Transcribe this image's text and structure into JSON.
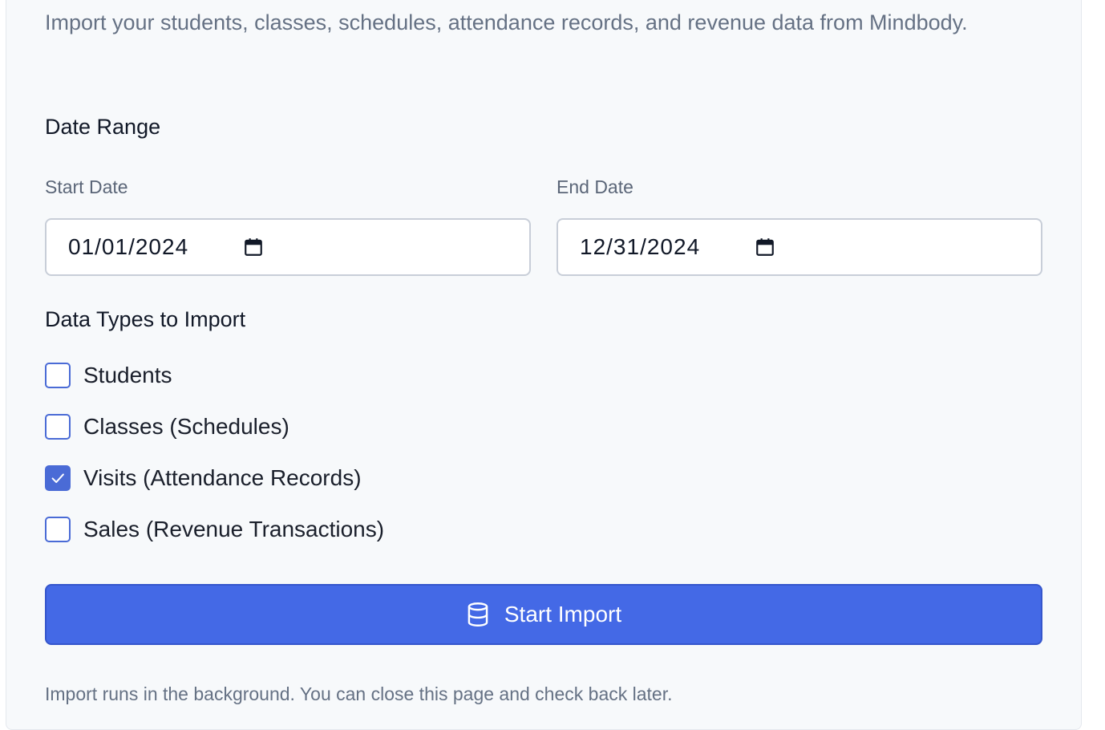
{
  "intro": {
    "description": "Import your students, classes, schedules, attendance records, and revenue data from Mindbody."
  },
  "date_range": {
    "heading": "Date Range",
    "start": {
      "label": "Start Date",
      "value": "01/01/2024",
      "icon": "calendar-icon"
    },
    "end": {
      "label": "End Date",
      "value": "12/31/2024",
      "icon": "calendar-icon"
    }
  },
  "data_types": {
    "heading": "Data Types to Import",
    "options": [
      {
        "label": "Students",
        "checked": false
      },
      {
        "label": "Classes (Schedules)",
        "checked": false
      },
      {
        "label": "Visits (Attendance Records)",
        "checked": true
      },
      {
        "label": "Sales (Revenue Transactions)",
        "checked": false
      }
    ]
  },
  "actions": {
    "start_import_label": "Start Import",
    "start_import_icon": "database-icon"
  },
  "footnote": "Import runs in the background. You can close this page and check back later.",
  "colors": {
    "accent": "#4469e6",
    "checkbox": "#4a6bd6",
    "muted_text": "#657184",
    "card_bg": "#f7f9fb"
  }
}
